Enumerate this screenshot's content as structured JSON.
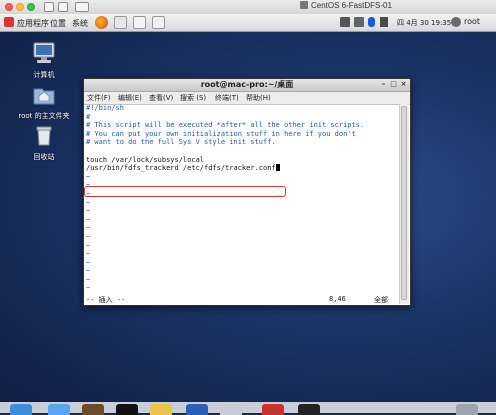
{
  "vm_window": {
    "title": "CentOS 6-FastDFS-01"
  },
  "panel": {
    "menus": [
      "应用程序",
      "位置",
      "系统"
    ],
    "clock": "四 4月 30 19:35",
    "user": "root"
  },
  "desktop": {
    "icons": [
      {
        "label": "计算机",
        "icon": "computer-icon"
      },
      {
        "label": "root 的主文件夹",
        "icon": "home-folder-icon"
      },
      {
        "label": "回收站",
        "icon": "trash-icon"
      }
    ]
  },
  "terminal": {
    "title": "root@mac-pro:~/桌面",
    "menu": [
      "文件(F)",
      "编辑(E)",
      "查看(V)",
      "搜索 (S)",
      "终端(T)",
      "帮助(H)"
    ],
    "lines": [
      {
        "text": "#!/bin/sh",
        "kind": "cmt"
      },
      {
        "text": "#",
        "kind": "cmt"
      },
      {
        "text": "# This script will be executed *after* all the other init scripts.",
        "kind": "cmt"
      },
      {
        "text": "# You can put your own initialization stuff in here if you don't",
        "kind": "cmt"
      },
      {
        "text": "# want to do the full Sys V style init stuff.",
        "kind": "cmt"
      },
      {
        "text": "",
        "kind": "cmd"
      },
      {
        "text": "touch /var/lock/subsys/local",
        "kind": "cmd"
      },
      {
        "text": "/usr/bin/fdfs_trackerd /etc/fdfs/tracker.conf",
        "kind": "cmd"
      }
    ],
    "tilde_count": 15,
    "status_mode": "-- 插入 --",
    "status_pos": "8,46",
    "status_scroll": "全部"
  },
  "colors": {
    "highlight": "#d9352c",
    "comment": "#1f57c9"
  }
}
